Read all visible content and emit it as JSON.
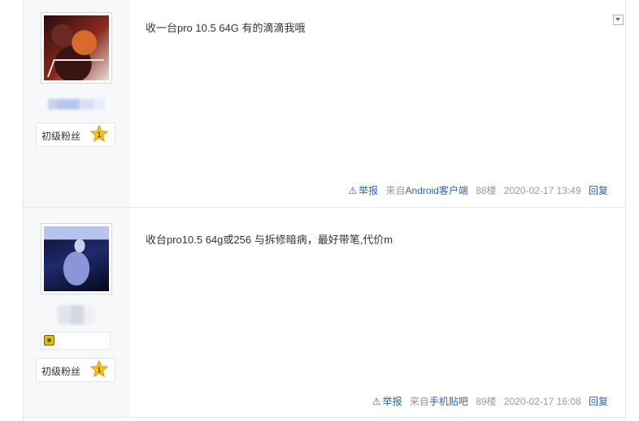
{
  "posts": [
    {
      "content": "收一台pro 10.5 64G 有的滴滴我哦",
      "level_name": "初级粉丝",
      "level_number": "1",
      "report_label": "举报",
      "source_prefix": "来自",
      "source_link": "Android客户端",
      "floor": "88楼",
      "time": "2020-02-17 13:49",
      "reply_label": "回复"
    },
    {
      "content": "收台pro10.5 64g或256 与拆修暗病，最好带笔,代价m",
      "level_name": "初级粉丝",
      "level_number": "1",
      "report_label": "举报",
      "source_prefix": "来自",
      "source_link": "手机贴吧",
      "floor": "89楼",
      "time": "2020-02-17 16:08",
      "reply_label": "回复"
    }
  ],
  "colors": {
    "link": "#2d64b3",
    "meta": "#999999",
    "sidebar_bg": "#f7f8fa",
    "badge_gold": "#f5c518"
  },
  "icons": [
    "warning-icon",
    "level-star-icon",
    "medal-icon",
    "dropdown-arrow-icon"
  ]
}
